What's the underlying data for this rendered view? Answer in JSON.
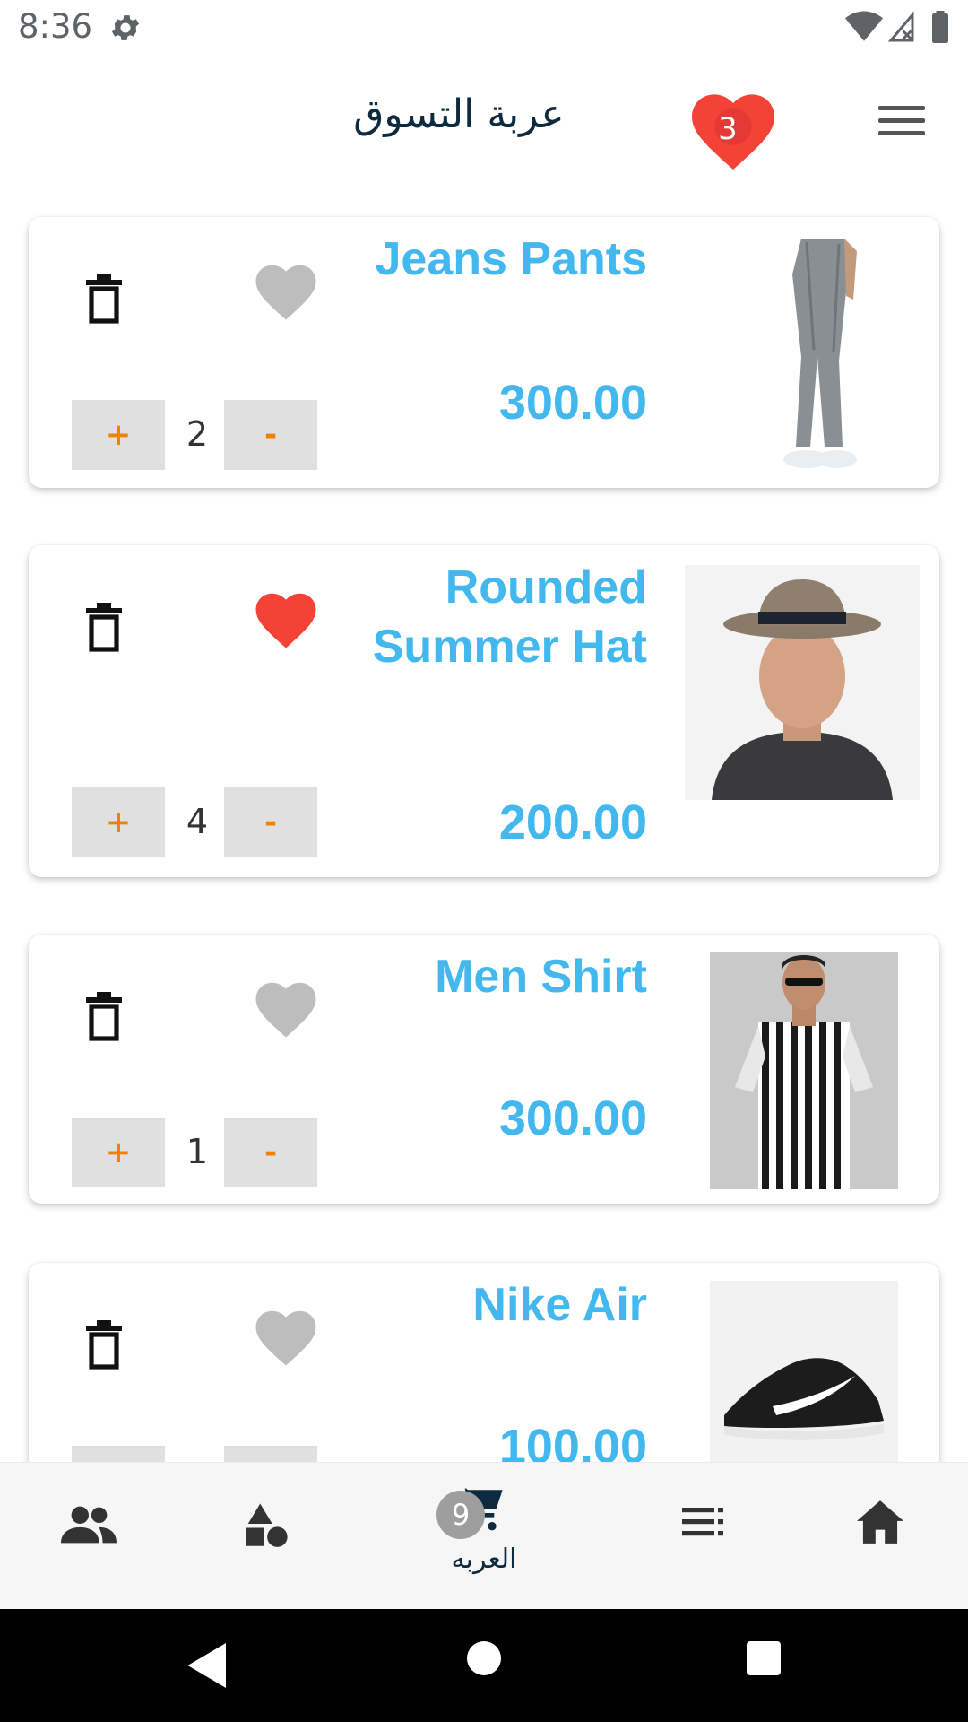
{
  "status_bar": {
    "time": "8:36",
    "icons": [
      "gear-icon",
      "wifi-icon",
      "signal-icon",
      "battery-icon"
    ]
  },
  "header": {
    "title": "عربة التسوق",
    "favorites_count": "3",
    "menu_icon": "hamburger-menu-icon"
  },
  "colors": {
    "accent": "#42b8ef",
    "qty_text": "#f08200",
    "heart_active": "#f44336",
    "heart_inactive": "#bdbdbd",
    "title": "#0d2a3e"
  },
  "cart_items": [
    {
      "name": "Jeans Pants",
      "price": "300.00",
      "quantity": "2",
      "favorited": false,
      "plus": "+",
      "minus": "-"
    },
    {
      "name": "Rounded Summer Hat",
      "price": "200.00",
      "quantity": "4",
      "favorited": true,
      "plus": "+",
      "minus": "-"
    },
    {
      "name": "Men Shirt",
      "price": "300.00",
      "quantity": "1",
      "favorited": false,
      "plus": "+",
      "minus": "-"
    },
    {
      "name": "Nike Air",
      "price": "100.00",
      "quantity": "",
      "favorited": false,
      "plus": "+",
      "minus": "-"
    }
  ],
  "bottom_nav": {
    "items": [
      {
        "icon": "people-icon"
      },
      {
        "icon": "categories-icon"
      },
      {
        "icon": "cart-icon",
        "label": "العربه",
        "badge": "9",
        "active": true
      },
      {
        "icon": "list-icon"
      },
      {
        "icon": "home-icon"
      }
    ]
  },
  "system_nav": {
    "icons": [
      "back-icon",
      "home-circle-icon",
      "recents-icon"
    ]
  }
}
